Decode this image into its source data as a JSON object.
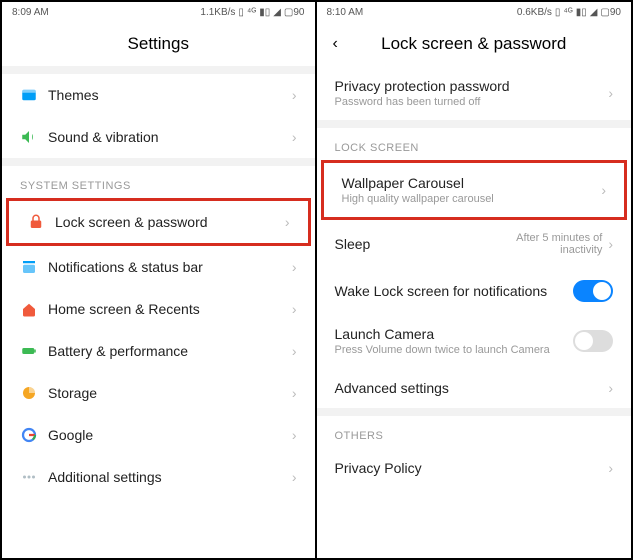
{
  "left": {
    "status": {
      "time": "8:09 AM",
      "speed": "1.1KB/s",
      "battery": "90"
    },
    "header": {
      "title": "Settings"
    },
    "items": [
      {
        "name": "themes",
        "label": "Themes",
        "icon": "themes-icon",
        "color": "#019ef7"
      },
      {
        "name": "sound",
        "label": "Sound & vibration",
        "icon": "sound-icon",
        "color": "#3cba54"
      }
    ],
    "section_label": "SYSTEM SETTINGS",
    "system_items": [
      {
        "name": "lock-screen",
        "label": "Lock screen & password",
        "icon": "lock-icon",
        "color": "#f05a3c",
        "highlight": true
      },
      {
        "name": "notifications",
        "label": "Notifications & status bar",
        "icon": "notifications-icon",
        "color": "#019ef7"
      },
      {
        "name": "home-recents",
        "label": "Home screen & Recents",
        "icon": "home-icon",
        "color": "#f05a3c"
      },
      {
        "name": "battery",
        "label": "Battery & performance",
        "icon": "battery-icon",
        "color": "#3cba54"
      },
      {
        "name": "storage",
        "label": "Storage",
        "icon": "storage-icon",
        "color": "#f5a623"
      },
      {
        "name": "google",
        "label": "Google",
        "icon": "google-icon",
        "color": "#4285f4"
      },
      {
        "name": "additional",
        "label": "Additional settings",
        "icon": "dots-icon",
        "color": "#b0bec5"
      }
    ]
  },
  "right": {
    "status": {
      "time": "8:10 AM",
      "speed": "0.6KB/s",
      "battery": "90"
    },
    "header": {
      "title": "Lock screen & password",
      "back": "‹"
    },
    "items": [
      {
        "name": "privacy-password",
        "title": "Privacy protection password",
        "subtitle": "Password has been turned off",
        "chevron": true
      }
    ],
    "section1_label": "LOCK SCREEN",
    "lock_items": [
      {
        "name": "wallpaper-carousel",
        "title": "Wallpaper Carousel",
        "subtitle": "High quality wallpaper carousel",
        "chevron": true,
        "highlight": true
      },
      {
        "name": "sleep",
        "title": "Sleep",
        "value": "After 5 minutes of inactivity",
        "chevron": true
      },
      {
        "name": "wake-lock",
        "title": "Wake Lock screen for notifications",
        "toggle": "on"
      },
      {
        "name": "launch-camera",
        "title": "Launch Camera",
        "subtitle": "Press Volume down twice to launch Camera",
        "toggle": "off"
      },
      {
        "name": "advanced",
        "title": "Advanced settings",
        "chevron": true
      }
    ],
    "section2_label": "OTHERS",
    "others": [
      {
        "name": "privacy-policy",
        "title": "Privacy Policy",
        "chevron": true
      }
    ]
  }
}
